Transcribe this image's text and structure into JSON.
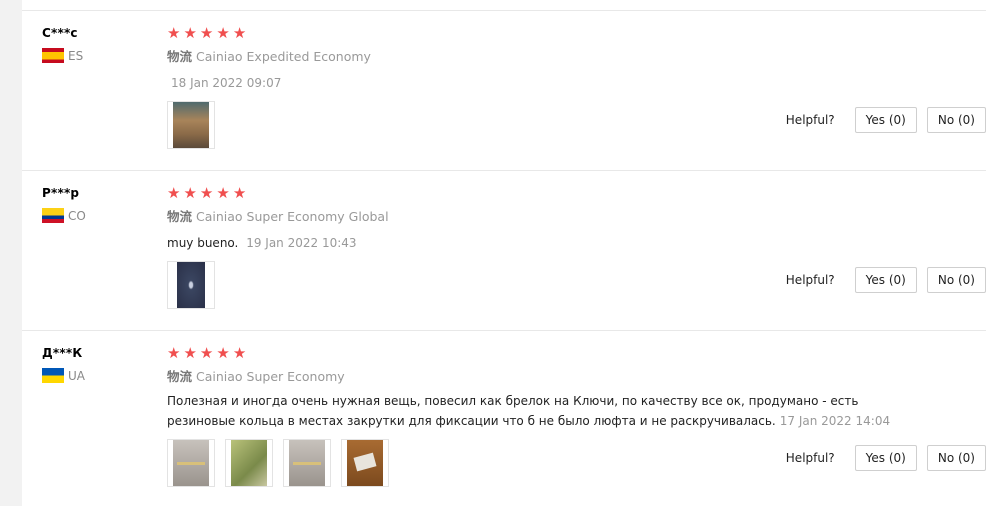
{
  "reviews": [
    {
      "username": "С***с",
      "country": "ES",
      "stars": 5,
      "logistics_prefix": "物流",
      "logistics": "Cainiao Expedited Economy",
      "text": "",
      "date": "18 Jan 2022 09:07",
      "helpful_label": "Helpful?",
      "yes_label": "Yes (0)",
      "no_label": "No (0)"
    },
    {
      "username": "P***p",
      "country": "CO",
      "stars": 5,
      "logistics_prefix": "物流",
      "logistics": "Cainiao Super Economy Global",
      "text": "muy bueno.",
      "date": "19 Jan 2022 10:43",
      "helpful_label": "Helpful?",
      "yes_label": "Yes (0)",
      "no_label": "No (0)"
    },
    {
      "username": "Д***К",
      "country": "UA",
      "stars": 5,
      "logistics_prefix": "物流",
      "logistics": "Cainiao Super Economy",
      "text_line1": "Полезная и иногда очень нужная вещь, повесил как брелок на Ключи, по качеству все ок, продумано - есть",
      "text_line2": "резиновые кольца в местах закрутки для фиксации что б не было люфта и не раскручивалась.",
      "date": "17 Jan 2022 14:04",
      "helpful_label": "Helpful?",
      "yes_label": "Yes (0)",
      "no_label": "No (0)"
    }
  ],
  "icons": {
    "star": "star-icon"
  },
  "colors": {
    "star": "#f04f4f",
    "meta_gray": "#999999",
    "border": "#cfcfcf"
  }
}
